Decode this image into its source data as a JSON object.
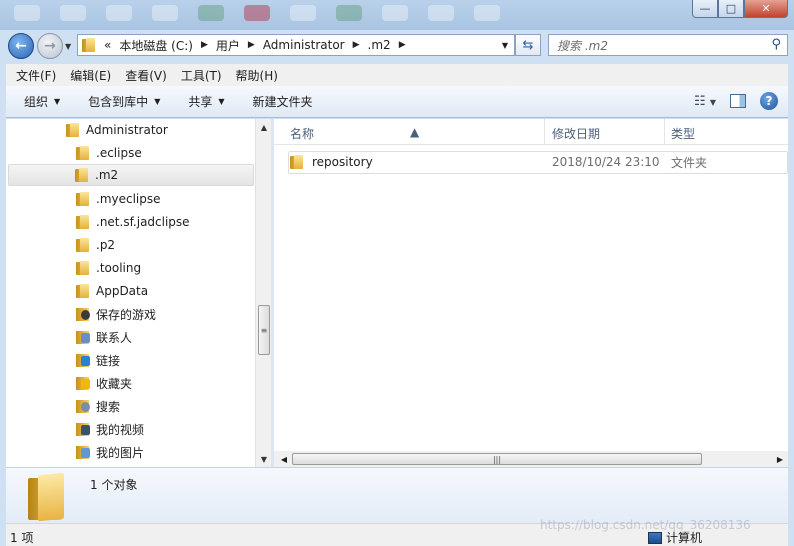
{
  "window": {
    "min_label": "—",
    "max_label": "□",
    "close_label": "✕"
  },
  "address": {
    "overflow": "«",
    "crumbs": [
      "本地磁盘 (C:)",
      "用户",
      "Administrator",
      ".m2"
    ],
    "sep": "▶"
  },
  "search": {
    "placeholder": "搜索 .m2"
  },
  "menu": [
    "文件(F)",
    "编辑(E)",
    "查看(V)",
    "工具(T)",
    "帮助(H)"
  ],
  "toolbar": {
    "organize": "组织",
    "include": "包含到库中",
    "share": "共享",
    "new_folder": "新建文件夹"
  },
  "nav": {
    "items": [
      {
        "label": "Administrator"
      },
      {
        "label": ".eclipse"
      },
      {
        "label": ".m2"
      },
      {
        "label": ".myeclipse"
      },
      {
        "label": ".net.sf.jadclipse"
      },
      {
        "label": ".p2"
      },
      {
        "label": ".tooling"
      },
      {
        "label": "AppData"
      },
      {
        "label": "保存的游戏"
      },
      {
        "label": "联系人"
      },
      {
        "label": "链接"
      },
      {
        "label": "收藏夹"
      },
      {
        "label": "搜索"
      },
      {
        "label": "我的视频"
      },
      {
        "label": "我的图片"
      }
    ]
  },
  "columns": {
    "name": "名称",
    "modified": "修改日期",
    "type": "类型"
  },
  "files": [
    {
      "name": "repository",
      "modified": "2018/10/24 23:10",
      "type": "文件夹"
    }
  ],
  "details": {
    "count": "1 个对象"
  },
  "status": {
    "items": "1 项",
    "location": "计算机"
  },
  "watermark": "https://blog.csdn.net/qq_36208136"
}
